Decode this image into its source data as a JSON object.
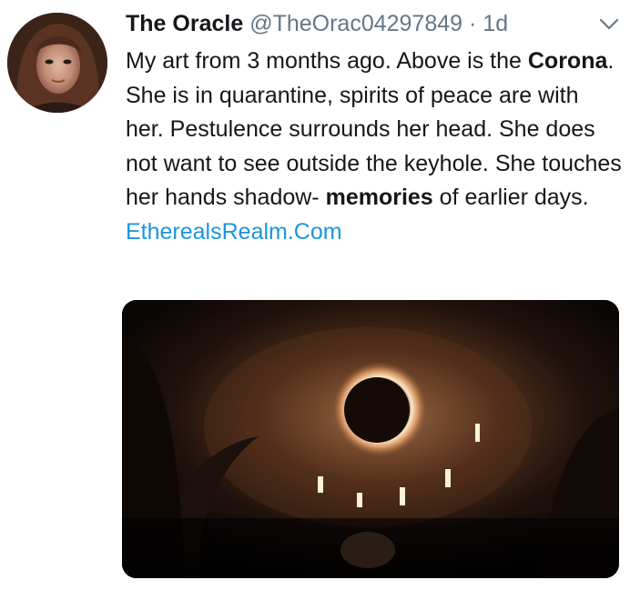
{
  "tweet": {
    "display_name": "The Oracle",
    "handle": "@TheOrac04297849",
    "separator": "·",
    "timestamp": "1d",
    "text_parts": {
      "p1": "My art from 3 months ago. Above is the ",
      "bold1": "Corona",
      "p2": ". She is in quarantine, spirits of peace are with her. Pestulence surrounds her head. She does not want to see outside the keyhole. She touches her hands shadow- ",
      "bold2": "memories",
      "p3": " of earlier days. ",
      "link": "EtherealsRealm.Com"
    },
    "avatar_icon": "profile-photo",
    "menu_icon": "chevron-down-icon",
    "media_description_icon": "eclipse-dome-artwork"
  },
  "colors": {
    "text": "#14171a",
    "secondary": "#657786",
    "link": "#1b95e0"
  }
}
